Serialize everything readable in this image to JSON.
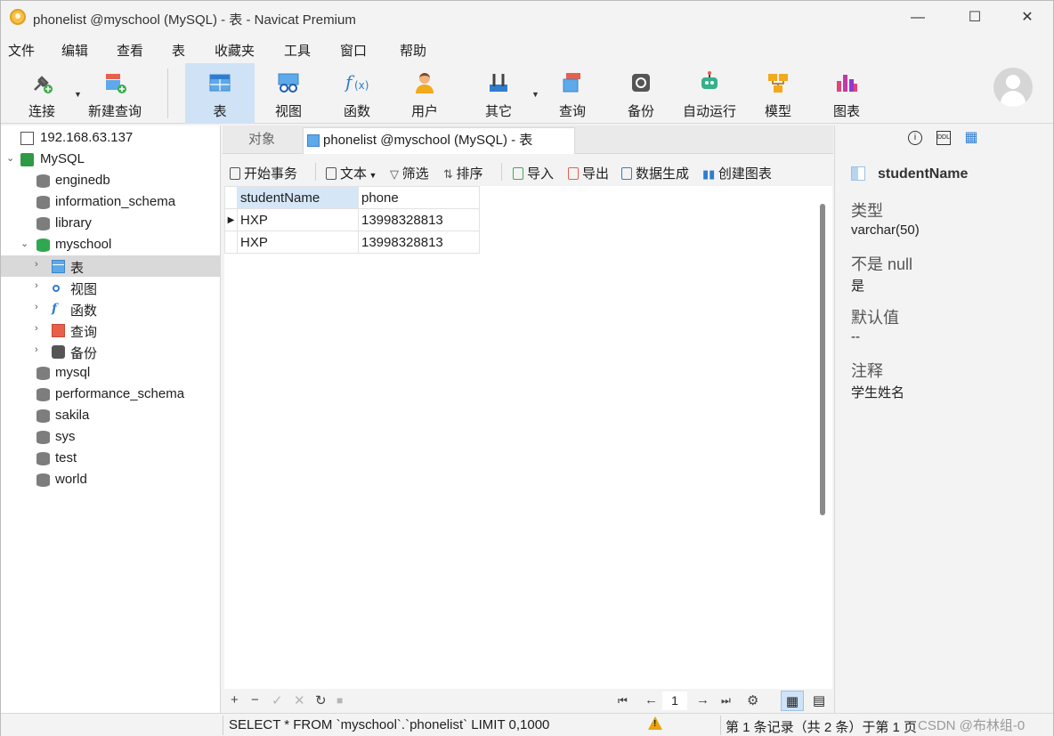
{
  "window": {
    "title": "phonelist @myschool (MySQL) - 表 - Navicat Premium",
    "minimize": "—",
    "maximize": "☐",
    "close": "✕"
  },
  "menu": [
    "文件",
    "编辑",
    "查看",
    "表",
    "收藏夹",
    "工具",
    "窗口",
    "帮助"
  ],
  "toolbar": {
    "connect": "连接",
    "new_query": "新建查询",
    "table": "表",
    "view": "视图",
    "function": "函数",
    "user": "用户",
    "other": "其它",
    "query": "查询",
    "backup": "备份",
    "automation": "自动运行",
    "model": "模型",
    "chart": "图表"
  },
  "tree": {
    "server": "192.168.63.137",
    "connection": "MySQL",
    "databases": [
      "enginedb",
      "information_schema",
      "library",
      "myschool",
      "mysql",
      "performance_schema",
      "sakila",
      "sys",
      "test",
      "world"
    ],
    "myschool_children": [
      "表",
      "视图",
      "函数",
      "查询",
      "备份"
    ]
  },
  "tabs": {
    "objects": "对象",
    "active": "phonelist @myschool (MySQL) - 表"
  },
  "table_toolbar": {
    "begin_transaction": "开始事务",
    "text": "文本",
    "filter": "筛选",
    "sort": "排序",
    "import": "导入",
    "export": "导出",
    "data_generation": "数据生成",
    "create_chart": "创建图表"
  },
  "grid": {
    "columns": [
      "studentName",
      "phone"
    ],
    "rows": [
      [
        "HXP",
        "13998328813"
      ],
      [
        "HXP",
        "13998328813"
      ]
    ]
  },
  "grid_nav": {
    "add": "+",
    "delete": "−",
    "apply": "✓",
    "discard": "✕",
    "refresh": "↻",
    "stop": "■",
    "first": "⏮",
    "prev": "←",
    "page": "1",
    "next": "→",
    "last": "⏭",
    "settings": "⚙"
  },
  "field_info": {
    "name": "studentName",
    "type_label": "类型",
    "type_value": "varchar(50)",
    "notnull_label": "不是 null",
    "notnull_value": "是",
    "default_label": "默认值",
    "default_value": "--",
    "comment_label": "注释",
    "comment_value": "学生姓名"
  },
  "status": {
    "sql": "SELECT * FROM `myschool`.`phonelist` LIMIT 0,1000",
    "record": "第 1 条记录（共 2 条）于第 1 页",
    "watermark": "CSDN @布林组-0"
  },
  "colors": {
    "accent": "#cfe2f6",
    "grid_header_selected": "#d5e6f7",
    "warning": "#e9a30b"
  }
}
